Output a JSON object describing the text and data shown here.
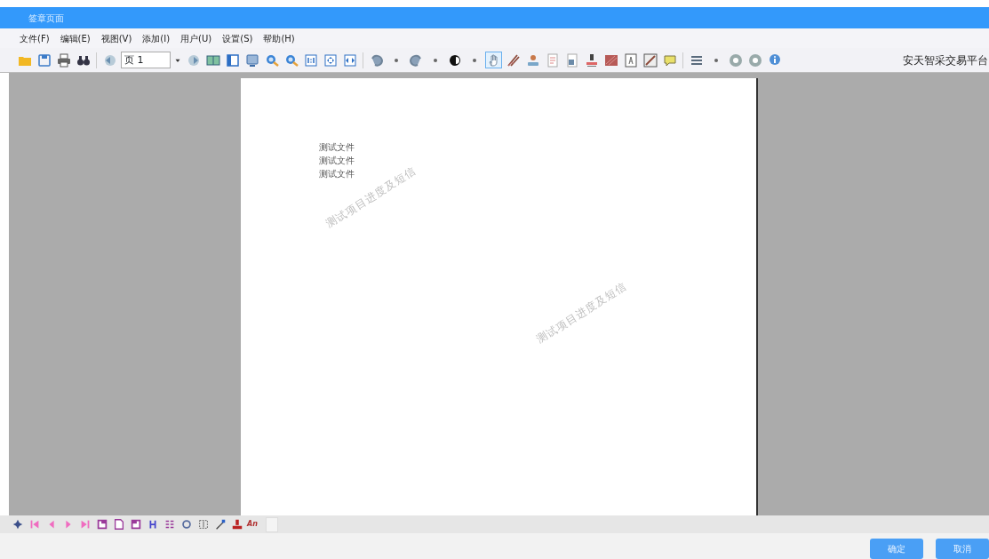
{
  "window": {
    "title": "签章页面"
  },
  "menu": [
    "文件(F)",
    "编辑(E)",
    "视图(V)",
    "添加(I)",
    "用户(U)",
    "设置(S)",
    "帮助(H)"
  ],
  "toolbar": {
    "tools": [
      {
        "kind": "icon",
        "selected": false
      },
      {
        "kind": "icon",
        "selected": false
      },
      {
        "kind": "icon",
        "selected": false
      },
      {
        "kind": "icon",
        "selected": false
      },
      {
        "kind": "separator"
      },
      {
        "kind": "icon",
        "selected": false
      },
      {
        "kind": "page_field",
        "value": "页 1"
      },
      {
        "kind": "icon",
        "selected": false
      },
      {
        "kind": "icon",
        "selected": false
      },
      {
        "kind": "icon",
        "selected": false
      },
      {
        "kind": "icon",
        "selected": false
      },
      {
        "kind": "icon",
        "selected": false
      },
      {
        "kind": "icon",
        "selected": false
      },
      {
        "kind": "icon",
        "selected": false
      },
      {
        "kind": "icon",
        "selected": false
      },
      {
        "kind": "icon",
        "selected": false
      },
      {
        "kind": "separator"
      },
      {
        "kind": "icon",
        "selected": false
      },
      {
        "kind": "icon",
        "selected": false
      },
      {
        "kind": "icon",
        "selected": false
      },
      {
        "kind": "icon",
        "selected": false
      },
      {
        "kind": "icon",
        "selected": false
      },
      {
        "kind": "icon",
        "selected": false
      },
      {
        "kind": "icon",
        "selected": true
      },
      {
        "kind": "icon",
        "selected": false
      },
      {
        "kind": "icon",
        "selected": false
      },
      {
        "kind": "icon",
        "selected": false
      },
      {
        "kind": "icon",
        "selected": false
      },
      {
        "kind": "icon",
        "selected": false
      },
      {
        "kind": "icon",
        "selected": false
      },
      {
        "kind": "icon",
        "selected": false
      },
      {
        "kind": "icon",
        "selected": false
      },
      {
        "kind": "icon",
        "selected": false
      },
      {
        "kind": "separator"
      },
      {
        "kind": "icon",
        "selected": false
      },
      {
        "kind": "icon",
        "selected": false
      },
      {
        "kind": "icon",
        "selected": false
      },
      {
        "kind": "icon",
        "selected": false
      },
      {
        "kind": "icon",
        "selected": false
      }
    ],
    "brand": "安天智采交易平台"
  },
  "document": {
    "lines": [
      "测试文件",
      "测试文件",
      "测试文件"
    ],
    "watermarks": [
      "测试项目进度及短信",
      "测试项目进度及短信"
    ]
  },
  "bottom_toolbar": {
    "tools": [
      {
        "kind": "icon"
      },
      {
        "kind": "icon"
      },
      {
        "kind": "icon"
      },
      {
        "kind": "icon"
      },
      {
        "kind": "icon"
      },
      {
        "kind": "icon"
      },
      {
        "kind": "icon"
      },
      {
        "kind": "icon"
      },
      {
        "kind": "icon"
      },
      {
        "kind": "icon"
      },
      {
        "kind": "icon"
      },
      {
        "kind": "icon"
      },
      {
        "kind": "icon"
      },
      {
        "kind": "icon"
      },
      {
        "kind": "text_tool",
        "label": "An"
      }
    ]
  },
  "buttons": [
    "确定",
    "取消"
  ]
}
